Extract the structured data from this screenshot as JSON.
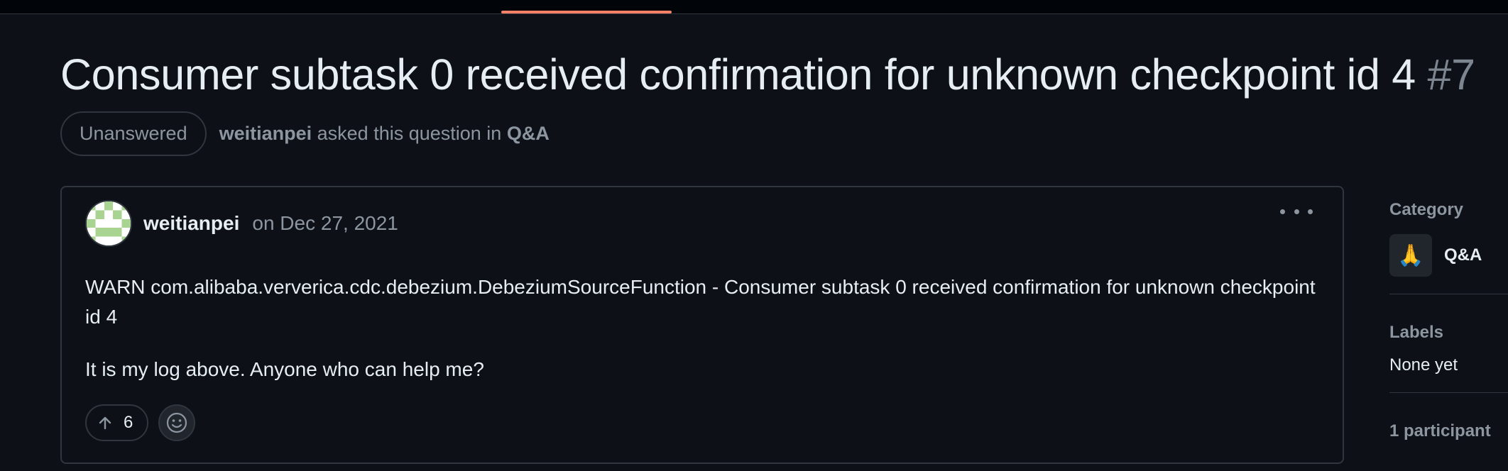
{
  "discussion": {
    "title": "Consumer subtask 0 received confirmation for unknown checkpoint id 4",
    "number": "#7",
    "state_badge": "Unanswered",
    "author": "weitianpei",
    "asked_text": "asked this question in",
    "category": "Q&A"
  },
  "comment": {
    "author": "weitianpei",
    "date": "on Dec 27, 2021",
    "body_line1": "WARN com.alibaba.ververica.cdc.debezium.DebeziumSourceFunction - Consumer subtask 0 received confirmation for unknown checkpoint id 4",
    "body_line2": "It is my log above. Anyone who can help me?",
    "upvote_count": "6",
    "icons": {
      "more": "kebab-horizontal-icon",
      "upvote": "arrow-up-icon",
      "reaction": "smiley-icon"
    }
  },
  "sidebar": {
    "category_heading": "Category",
    "category_emoji": "🙏",
    "category_name": "Q&A",
    "labels_heading": "Labels",
    "labels_value": "None yet",
    "participants_heading": "1 participant"
  },
  "colors": {
    "background": "#0d1117",
    "border": "#30363d",
    "muted": "#8d96a0",
    "text": "#e6edf3",
    "accent": "#f78166"
  }
}
